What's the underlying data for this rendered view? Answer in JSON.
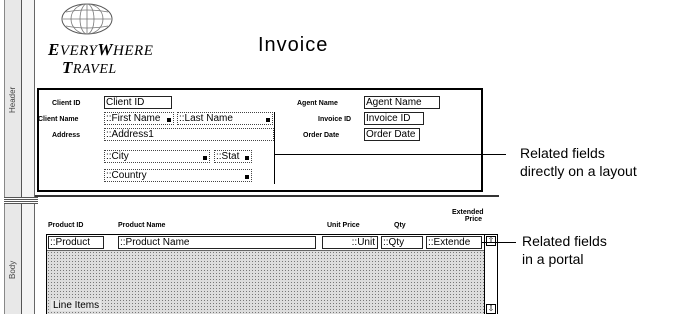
{
  "parts": {
    "header": "Header",
    "body": "Body"
  },
  "logo": {
    "line1_cap": "E",
    "line1_rest1": "VERY",
    "line1_cap2": "W",
    "line1_rest2": "HERE",
    "line2_cap": "T",
    "line2_rest": "RAVEL"
  },
  "title": "Invoice",
  "header_fields": {
    "client_id_label": "Client ID",
    "client_id": "Client ID",
    "client_name_label": "Client Name",
    "first_name": "::First Name",
    "last_name": "::Last Name",
    "address_label": "Address",
    "address1": "::Address1",
    "city": "::City",
    "state": "::Stat",
    "country": "::Country",
    "agent_name_label": "Agent Name",
    "agent_name": "Agent Name",
    "invoice_id_label": "Invoice ID",
    "invoice_id": "Invoice ID",
    "order_date_label": "Order Date",
    "order_date": "Order Date"
  },
  "columns": {
    "product_id": "Product ID",
    "product_name": "Product Name",
    "unit_price": "Unit Price",
    "qty": "Qty",
    "extended_line1": "Extended",
    "extended_line2": "Price"
  },
  "portal": {
    "product_id": "::Product",
    "product_name": "::Product Name",
    "unit_price": "::Unit",
    "qty": "::Qty",
    "extended": "::Extende",
    "label": "Line Items"
  },
  "callouts": {
    "layout_line1": "Related fields",
    "layout_line2": "directly on a layout",
    "portal_line1": "Related fields",
    "portal_line2": "in a portal"
  }
}
